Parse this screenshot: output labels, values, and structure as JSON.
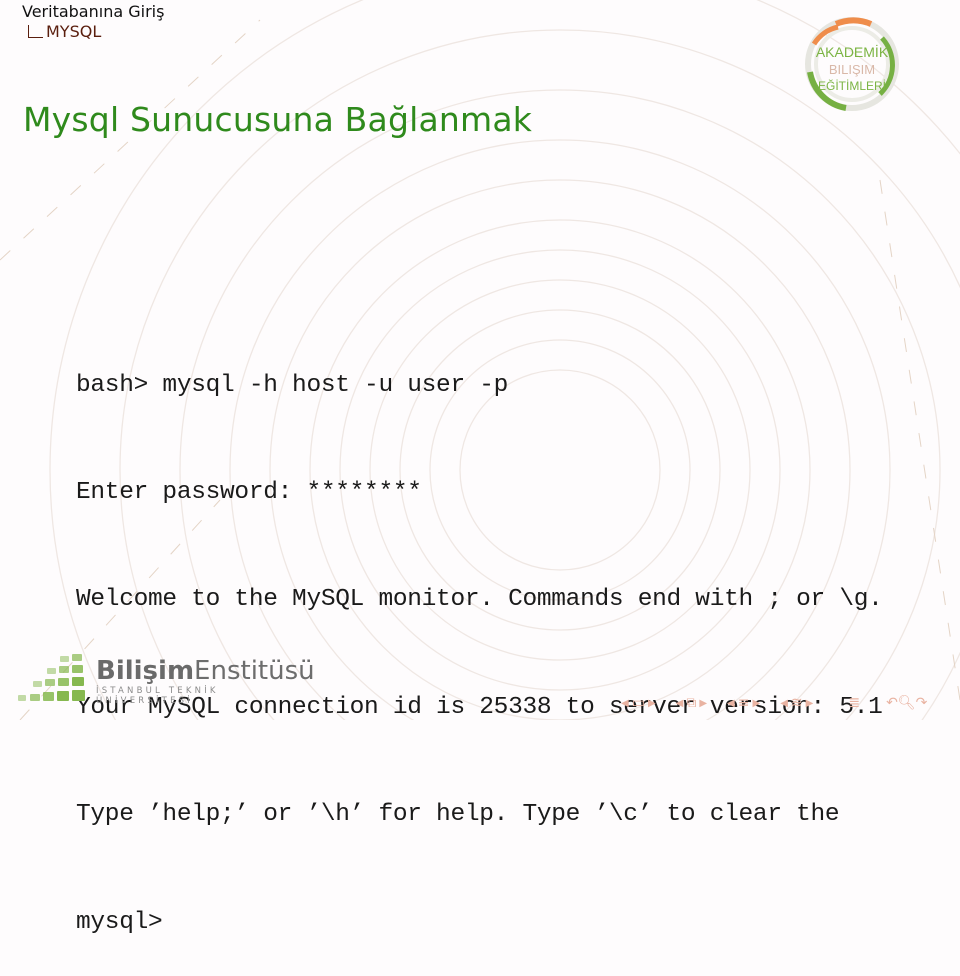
{
  "breadcrumb": {
    "section": "Veritabanına Giriş",
    "subsection": "MYSQL"
  },
  "slide": {
    "title": "Mysql Sunucusuna Bağlanmak"
  },
  "terminal": {
    "lines": [
      "bash> mysql -h host -u user -p",
      "Enter password: ********",
      "Welcome to the MySQL monitor. Commands end with ; or \\g.",
      "Your MySQL connection id is 25338 to server version: 5.1",
      "Type ’help;’ or ’\\h’ for help. Type ’\\c’ to clear the",
      "mysql>"
    ]
  },
  "logos": {
    "top_right": {
      "line1": "AKADEMİK",
      "line2": "BILIŞIM",
      "line3": "EĞİTİMLERİ"
    },
    "bottom_left": {
      "bold": "Bilişim",
      "regular": "Enstitüsü",
      "sub": "İSTANBUL TEKNİK ÜNİVERSİTESİ"
    }
  },
  "colors": {
    "title": "#2f8a1c",
    "subsection": "#5a1e0e",
    "logo_green": "#76b043",
    "logo_orange": "#ef8d4b",
    "nav": "#e9b3a2"
  },
  "navigation": {
    "icons": [
      "frame-prev",
      "frame",
      "frame-next",
      "subsection-prev",
      "subsection",
      "subsection-next",
      "section-prev",
      "section",
      "section-next",
      "presentation-prev",
      "presentation",
      "presentation-next",
      "outline",
      "undo",
      "search",
      "redo"
    ]
  }
}
